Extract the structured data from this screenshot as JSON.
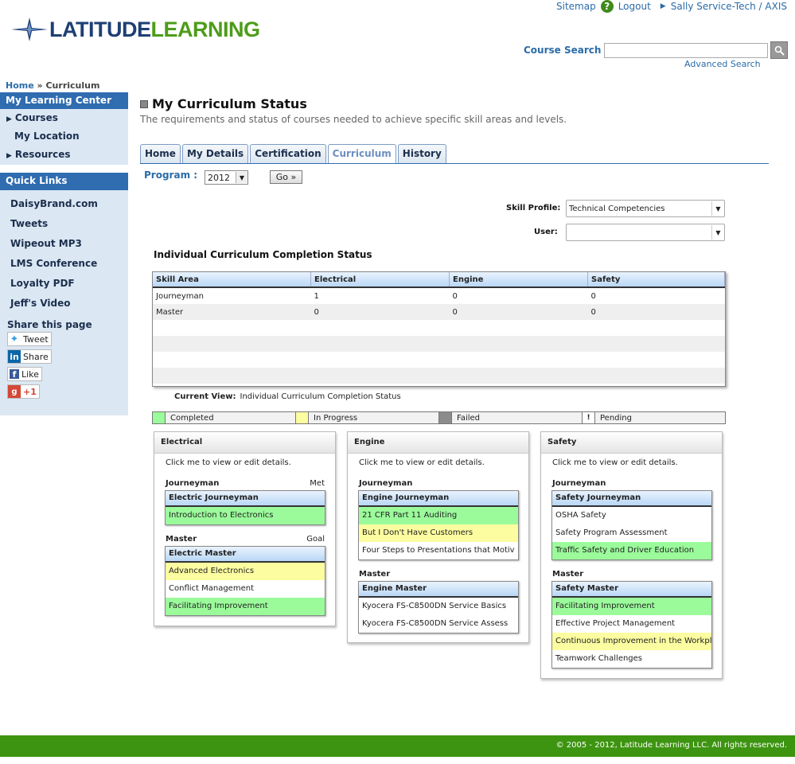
{
  "header": {
    "logo_part1": "LATITUDE",
    "logo_part2": "LEARNING",
    "sitemap": "Sitemap",
    "logout": "Logout",
    "user": "Sally Service-Tech / AXIS",
    "course_search_label": "Course Search",
    "course_search_value": "",
    "advanced_search": "Advanced Search"
  },
  "breadcrumb": {
    "home": "Home",
    "sep": "»",
    "current": "Curriculum"
  },
  "sidebar": {
    "my_learning_center": "My Learning Center",
    "items": [
      "Courses",
      "My Location",
      "Resources"
    ],
    "quick_links_title": "Quick Links",
    "quick_links": [
      "DaisyBrand.com",
      "Tweets",
      "Wipeout MP3",
      "LMS Conference",
      "Loyalty PDF",
      "Jeff's Video"
    ],
    "share_title": "Share this page",
    "share": {
      "tweet": "Tweet",
      "linkedin": "Share",
      "like": "Like",
      "gplus": "+1"
    }
  },
  "main": {
    "title": "My Curriculum Status",
    "subtitle": "The requirements and status of courses needed to achieve specific skill areas and levels.",
    "tabs": [
      "Home",
      "My Details",
      "Certification",
      "Curriculum",
      "History"
    ],
    "active_tab": "Curriculum",
    "program_label": "Program :",
    "program_value": "2012",
    "go_label": "Go »",
    "skill_profile_label": "Skill Profile:",
    "skill_profile_value": "Technical Competencies",
    "user_label": "User:",
    "user_value": "",
    "grid_title": "Individual Curriculum Completion Status",
    "grid_columns": [
      "Skill Area",
      "Electrical",
      "Engine",
      "Safety"
    ],
    "grid_rows": [
      [
        "Journeyman",
        "1",
        "0",
        "0"
      ],
      [
        "Master",
        "0",
        "0",
        "0"
      ]
    ],
    "current_view_label": "Current View:",
    "current_view_value": "Individual Curriculum Completion Status",
    "legend": [
      {
        "label": "Completed",
        "color": "#9bfb9b",
        "mark": ""
      },
      {
        "label": "In Progress",
        "color": "#fcfca0",
        "mark": ""
      },
      {
        "label": "Failed",
        "color": "#8c8c8c",
        "mark": ""
      },
      {
        "label": "Pending",
        "color": "#ffffff",
        "mark": "!"
      }
    ],
    "panels": [
      {
        "title": "Electrical",
        "hint": "Click me to view or edit details.",
        "levels": [
          {
            "name": "Journeyman",
            "status": "Met",
            "list_title": "Electric Journeyman",
            "courses": [
              {
                "name": "Introduction to Electronics",
                "state": "completed"
              }
            ]
          },
          {
            "name": "Master",
            "status": "Goal",
            "list_title": "Electric Master",
            "courses": [
              {
                "name": "Advanced Electronics",
                "state": "inprogress"
              },
              {
                "name": "Conflict Management",
                "state": ""
              },
              {
                "name": "Facilitating Improvement",
                "state": "completed"
              }
            ]
          }
        ]
      },
      {
        "title": "Engine",
        "hint": "Click me to view or edit details.",
        "levels": [
          {
            "name": "Journeyman",
            "status": "",
            "list_title": "Engine Journeyman",
            "courses": [
              {
                "name": "21 CFR Part 11 Auditing",
                "state": "completed"
              },
              {
                "name": "But I Don't Have Customers",
                "state": "inprogress"
              },
              {
                "name": "Four Steps to Presentations that Motiv",
                "state": ""
              }
            ]
          },
          {
            "name": "Master",
            "status": "",
            "list_title": "Engine Master",
            "courses": [
              {
                "name": "Kyocera FS-C8500DN Service Basics",
                "state": ""
              },
              {
                "name": "Kyocera FS-C8500DN Service Assess",
                "state": ""
              }
            ]
          }
        ]
      },
      {
        "title": "Safety",
        "hint": "Click me to view or edit details.",
        "levels": [
          {
            "name": "Journeyman",
            "status": "",
            "list_title": "Safety Journeyman",
            "courses": [
              {
                "name": "OSHA Safety",
                "state": ""
              },
              {
                "name": "Safety Program Assessment",
                "state": ""
              },
              {
                "name": "Traffic Safety and Driver Education",
                "state": "completed"
              }
            ]
          },
          {
            "name": "Master",
            "status": "",
            "list_title": "Safety Master",
            "courses": [
              {
                "name": "Facilitating Improvement",
                "state": "completed"
              },
              {
                "name": "Effective Project Management",
                "state": ""
              },
              {
                "name": "Continuous Improvement in the Workpl",
                "state": "inprogress"
              },
              {
                "name": "Teamwork Challenges",
                "state": ""
              }
            ]
          }
        ]
      }
    ]
  },
  "footer": {
    "copyright": "© 2005 - 2012, Latitude Learning LLC. All rights reserved."
  }
}
